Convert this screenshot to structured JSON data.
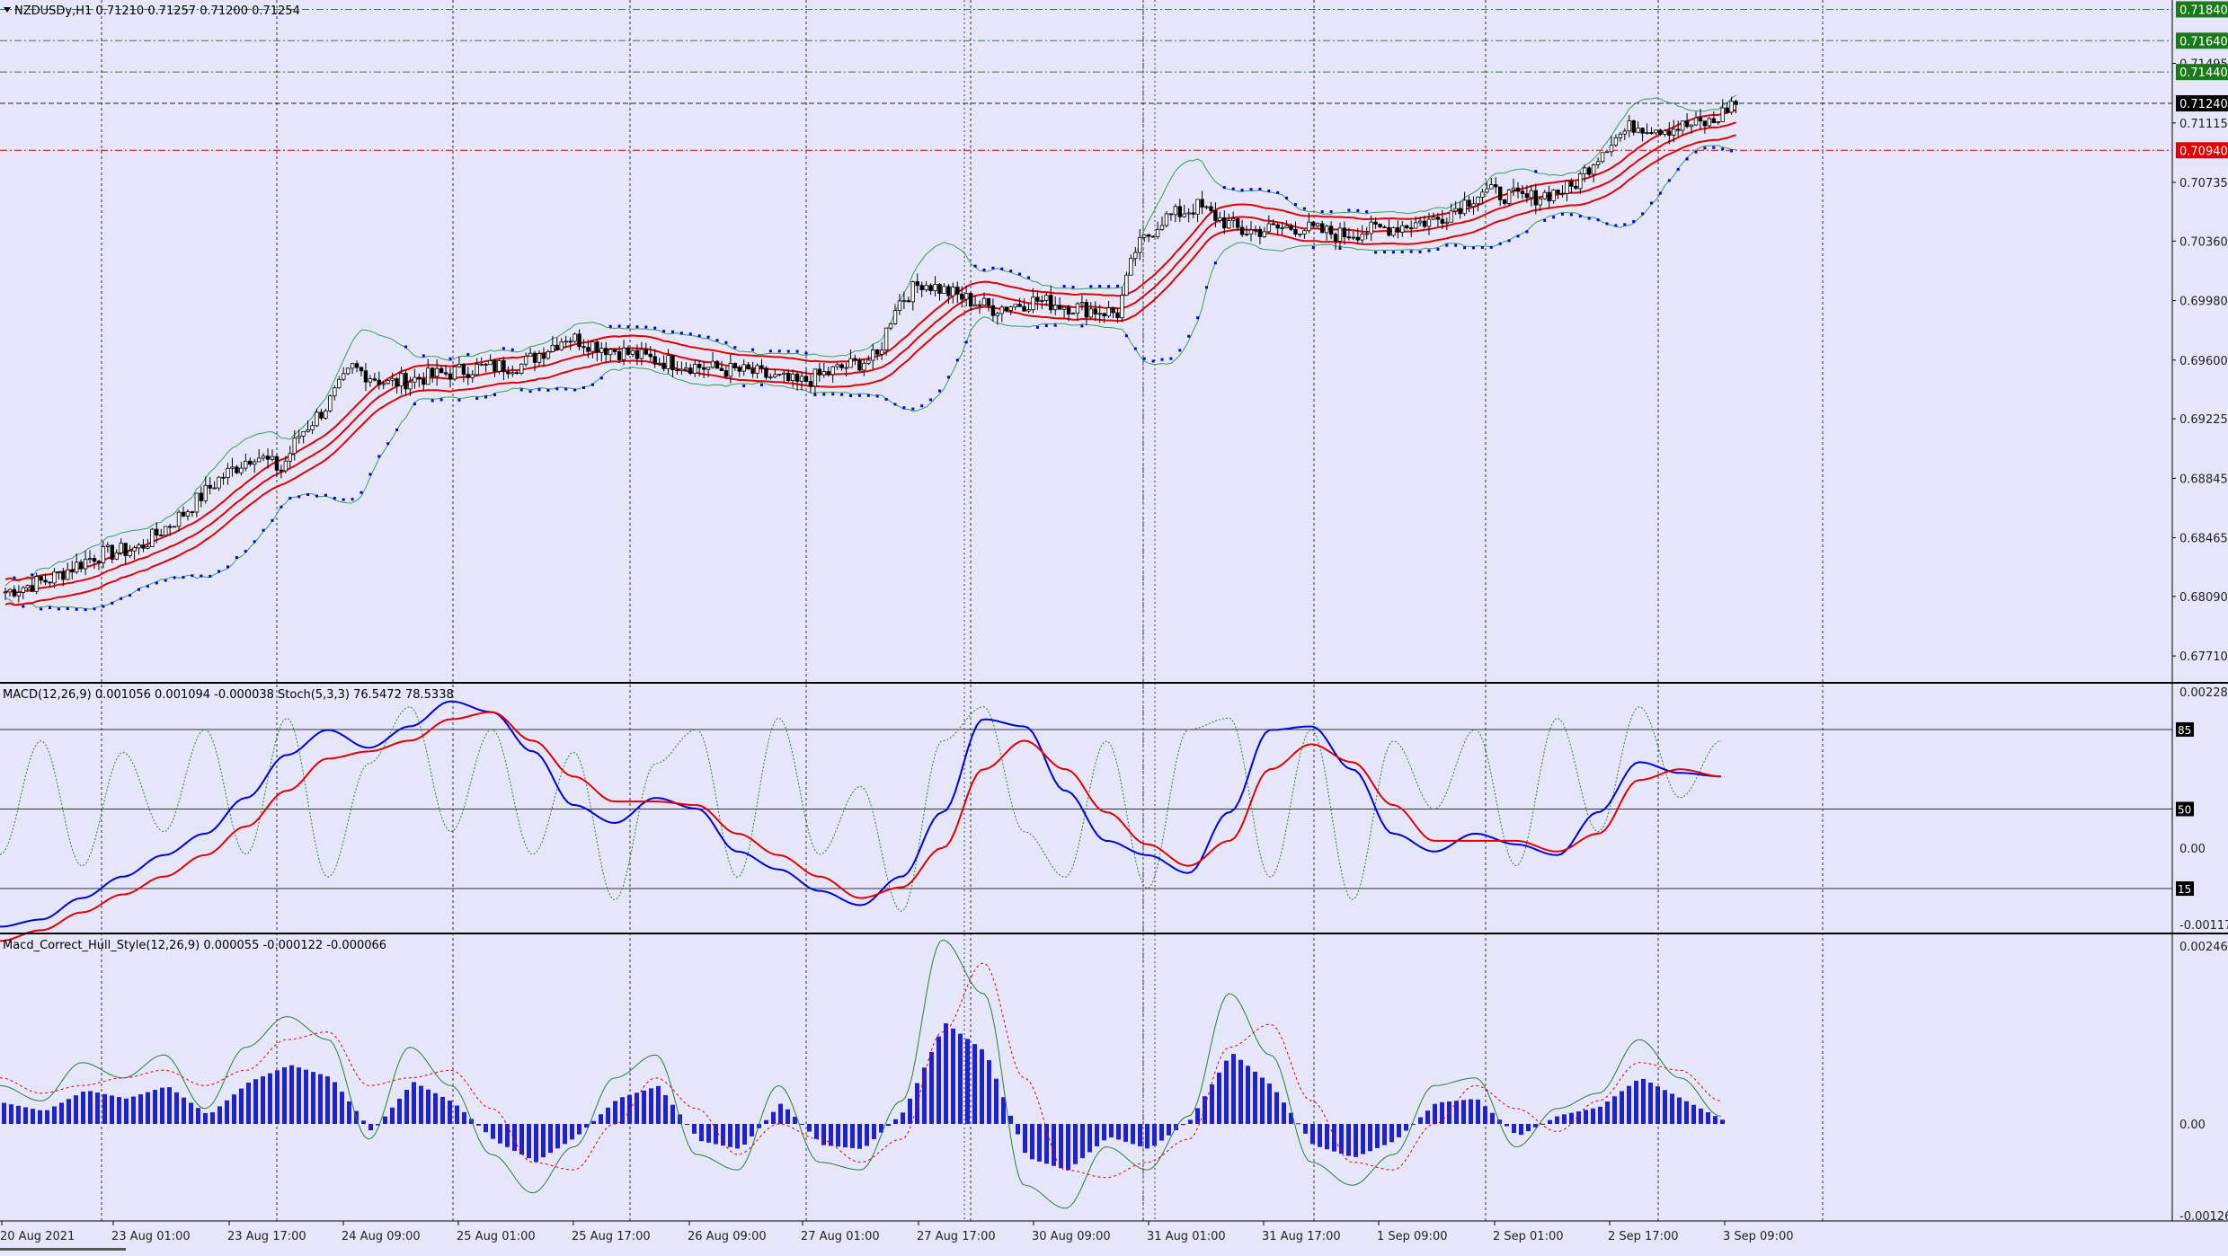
{
  "symbol_header": "NZDUSDy,H1  0.71210 0.71257 0.71200 0.71254",
  "macd_stoch_header": "MACD(12,26,9) 0.001056 0.001094 -0.000038  Stoch(5,3,3) 76.5472 78.5338",
  "hull_header": "Macd_Correct_Hull_Style(12,26,9) 0.000055 -0.000122 -0.000066",
  "colors": {
    "background": "#e6e6fa",
    "bull_candle": "#ffffff",
    "bear_candle": "#000000",
    "ma": "#e00000",
    "bollinger": "#3c9a55",
    "sar": "#0000ee",
    "macd_line": "#0000dd",
    "signal_line": "#e00000",
    "stoch": "#2e7d32",
    "histogram": "#1f1fd4",
    "label_green": "#1a7a1a",
    "label_red": "#e00000",
    "label_black": "#000000"
  },
  "chart_data": [
    {
      "type": "candlestick",
      "title": "NZDUSDy,H1",
      "ylim": [
        0.6755,
        0.719
      ],
      "x_tick_labels": [
        "20 Aug 2021",
        "23 Aug 01:00",
        "23 Aug 17:00",
        "24 Aug 09:00",
        "25 Aug 01:00",
        "25 Aug 17:00",
        "26 Aug 09:00",
        "27 Aug 01:00",
        "27 Aug 17:00",
        "30 Aug 09:00",
        "31 Aug 01:00",
        "31 Aug 17:00",
        "1 Sep 09:00",
        "2 Sep 01:00",
        "2 Sep 17:00",
        "3 Sep 09:00"
      ],
      "y_tick_labels": [
        "0.71840",
        "0.71640",
        "0.71495",
        "0.71440",
        "0.71240",
        "0.71115",
        "0.70940",
        "0.70735",
        "0.70360",
        "0.69980",
        "0.69600",
        "0.69225",
        "0.68845",
        "0.68465",
        "0.68090",
        "0.67710"
      ],
      "price_labels": [
        {
          "text": "0.71840",
          "style": "green"
        },
        {
          "text": "0.71640",
          "style": "green"
        },
        {
          "text": "0.71440",
          "style": "green"
        },
        {
          "text": "0.71240",
          "style": "black"
        },
        {
          "text": "0.70940",
          "style": "red"
        }
      ],
      "horizontal_levels": [
        0.7184,
        0.7164,
        0.7144,
        0.7124,
        0.7094
      ],
      "close_path": [
        [
          0,
          0.6812
        ],
        [
          10,
          0.682
        ],
        [
          20,
          0.6835
        ],
        [
          30,
          0.684
        ],
        [
          40,
          0.6862
        ],
        [
          48,
          0.6884
        ],
        [
          56,
          0.69
        ],
        [
          62,
          0.689
        ],
        [
          66,
          0.6912
        ],
        [
          72,
          0.693
        ],
        [
          78,
          0.6955
        ],
        [
          86,
          0.6945
        ],
        [
          96,
          0.695
        ],
        [
          106,
          0.6955
        ],
        [
          116,
          0.6957
        ],
        [
          126,
          0.6975
        ],
        [
          136,
          0.6967
        ],
        [
          146,
          0.696
        ],
        [
          158,
          0.6955
        ],
        [
          168,
          0.6952
        ],
        [
          178,
          0.6945
        ],
        [
          188,
          0.6955
        ],
        [
          196,
          0.6962
        ],
        [
          200,
          0.6995
        ],
        [
          206,
          0.701
        ],
        [
          214,
          0.7001
        ],
        [
          222,
          0.6993
        ],
        [
          232,
          0.6998
        ],
        [
          242,
          0.6993
        ],
        [
          250,
          0.699
        ],
        [
          254,
          0.703
        ],
        [
          260,
          0.705
        ],
        [
          268,
          0.7058
        ],
        [
          278,
          0.7042
        ],
        [
          290,
          0.7045
        ],
        [
          300,
          0.704
        ],
        [
          312,
          0.7045
        ],
        [
          322,
          0.705
        ],
        [
          332,
          0.7068
        ],
        [
          342,
          0.7063
        ],
        [
          352,
          0.707
        ],
        [
          360,
          0.7098
        ],
        [
          366,
          0.711
        ],
        [
          374,
          0.7108
        ],
        [
          384,
          0.7112
        ],
        [
          388,
          0.7124
        ]
      ],
      "series": [
        {
          "name": "Moving Averages",
          "kind": "line"
        },
        {
          "name": "Bollinger Bands",
          "kind": "line"
        },
        {
          "name": "Parabolic SAR",
          "kind": "dots"
        }
      ]
    },
    {
      "type": "line",
      "title": "MACD(12,26,9) / Stoch(5,3,3)",
      "y_tick_labels": [
        "0.002284",
        "0.00",
        "-0.001174"
      ],
      "level_labels": [
        "85",
        "50",
        "15"
      ],
      "levels": [
        85,
        50,
        15
      ],
      "series": [
        {
          "name": "MACD",
          "values": [
            -0.0011,
            -0.001,
            -0.0007,
            -0.0004,
            -0.0001,
            0.0002,
            0.0007,
            0.0013,
            0.00165,
            0.0014,
            0.0017,
            0.00205,
            0.0019,
            0.00135,
            0.0006,
            0.00035,
            0.0007,
            0.00055,
            -5e-05,
            -0.0003,
            -0.0006,
            -0.0008,
            -0.0004,
            0.0005,
            0.0018,
            0.0017,
            0.0008,
            0.0001,
            -0.0001,
            -0.00035,
            0.0005,
            0.00165,
            0.0017,
            0.0011,
            0.0002,
            -5e-05,
            0.0002,
            5e-05,
            -0.0001,
            0.0005,
            0.0012,
            0.00105,
            0.001
          ]
        },
        {
          "name": "Signal",
          "values": [
            -0.0013,
            -0.00115,
            -0.0009,
            -0.00065,
            -0.0004,
            -0.0001,
            0.0003,
            0.0008,
            0.00125,
            0.00135,
            0.0015,
            0.0018,
            0.0019,
            0.0015,
            0.001,
            0.00065,
            0.00065,
            0.0006,
            0.0002,
            -0.0001,
            -0.0004,
            -0.0007,
            -0.00055,
            0.0,
            0.0011,
            0.0015,
            0.0011,
            0.0005,
            5e-05,
            -0.00025,
            0.0001,
            0.0011,
            0.00145,
            0.0012,
            0.0006,
            0.0001,
            0.0001,
            0.0001,
            -5e-05,
            0.0002,
            0.00095,
            0.0011,
            0.001
          ]
        },
        {
          "name": "Stoch",
          "values": [
            30,
            80,
            25,
            75,
            40,
            85,
            30,
            90,
            20,
            70,
            95,
            40,
            85,
            30,
            75,
            10,
            70,
            85,
            20,
            90,
            30,
            60,
            5,
            80,
            95,
            40,
            20,
            80,
            15,
            85,
            90,
            20,
            85,
            10,
            80,
            50,
            85,
            25,
            90,
            40,
            95,
            55,
            80
          ]
        }
      ]
    },
    {
      "type": "bar",
      "title": "Macd_Correct_Hull_Style(12,26,9)",
      "y_tick_labels": [
        "0.002461",
        "0.00",
        "-0.001266"
      ],
      "series": [
        {
          "name": "Histogram",
          "kind": "bar"
        },
        {
          "name": "Hull line",
          "kind": "line",
          "values": [
            0.0005,
            0.0003,
            0.0008,
            0.0006,
            0.0009,
            0.0002,
            0.001,
            0.0014,
            0.0011,
            -0.0002,
            0.001,
            0.0005,
            -0.0004,
            -0.0009,
            -0.0003,
            0.0006,
            0.0009,
            -0.0004,
            -0.0006,
            0.0005,
            -0.0005,
            -0.0006,
            0.0003,
            0.0024,
            0.0017,
            -0.0008,
            -0.0011,
            -0.0003,
            -0.0006,
            0.0001,
            0.0017,
            0.0009,
            -0.0005,
            -0.0008,
            -0.0004,
            0.0005,
            0.0006,
            -0.0003,
            0.0002,
            0.0004,
            0.0011,
            0.0006,
            0.0001
          ]
        },
        {
          "name": "Signal",
          "kind": "dotted",
          "values": [
            0.0006,
            0.0004,
            0.0005,
            0.0006,
            0.0007,
            0.0005,
            0.0007,
            0.0011,
            0.0012,
            0.0005,
            0.0006,
            0.0007,
            0.0002,
            -0.0005,
            -0.0006,
            0.0,
            0.0006,
            0.0002,
            -0.0004,
            0.0,
            -0.0002,
            -0.0005,
            -0.0002,
            0.0012,
            0.0021,
            0.0006,
            -0.0006,
            -0.0007,
            -0.0005,
            -0.0002,
            0.001,
            0.0013,
            0.0003,
            -0.0005,
            -0.0006,
            0.0,
            0.0005,
            0.0002,
            -0.0001,
            0.0003,
            0.0008,
            0.0007,
            0.0003
          ]
        }
      ]
    }
  ]
}
